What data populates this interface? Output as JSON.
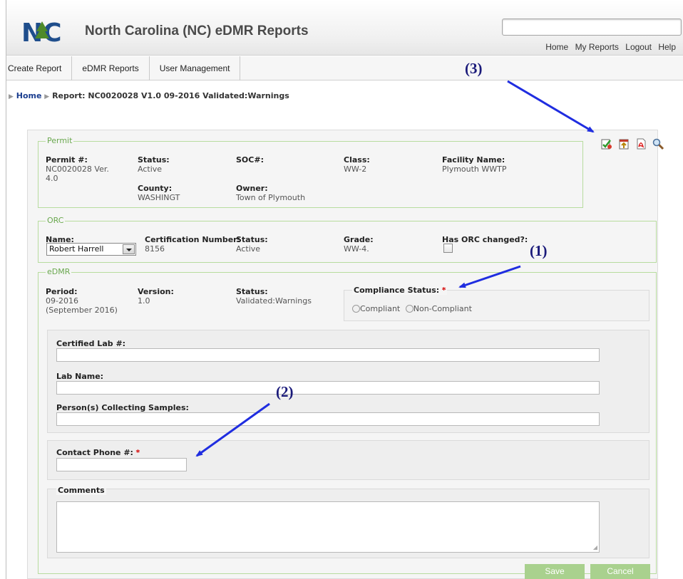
{
  "header": {
    "logo_text": "NC",
    "title": "North Carolina (NC) eDMR Reports",
    "search_placeholder": "",
    "links": [
      "Home",
      "My Reports",
      "Logout",
      "Help"
    ]
  },
  "nav": {
    "tabs": [
      "Create Report",
      "eDMR Reports",
      "User Management"
    ]
  },
  "breadcrumb": {
    "home": "Home",
    "current": "Report: NC0020028 V1.0 09-2016 Validated:Warnings"
  },
  "toolbar": {
    "icons": [
      "validate-icon",
      "upload-icon",
      "pdf-icon",
      "preview-icon"
    ]
  },
  "permit": {
    "legend": "Permit",
    "permit_label": "Permit #:",
    "permit_value_1": "NC0020028 Ver.",
    "permit_value_2": "4.0",
    "status_label": "Status:",
    "status_value": "Active",
    "county_label": "County:",
    "county_value": "WASHINGT",
    "soc_label": "SOC#:",
    "soc_value": "",
    "owner_label": "Owner:",
    "owner_value": "Town of Plymouth",
    "class_label": "Class:",
    "class_value": "WW-2",
    "facility_label": "Facility Name:",
    "facility_value": "Plymouth WWTP"
  },
  "orc": {
    "legend": "ORC",
    "name_label": "Name:",
    "name_value": "Robert Harrell",
    "cert_label": "Certification Number:",
    "cert_value": "8156",
    "status_label": "Status:",
    "status_value": "Active",
    "grade_label": "Grade:",
    "grade_value": "WW-4.",
    "changed_label": "Has ORC changed?:"
  },
  "edmr": {
    "legend": "eDMR",
    "period_label": "Period:",
    "period_value": "09-2016",
    "period_sub": "(September 2016)",
    "version_label": "Version:",
    "version_value": "1.0",
    "status_label": "Status:",
    "status_value": "Validated:Warnings",
    "compliance_label": "Compliance Status:",
    "compliance_options": [
      "Compliant",
      "Non-Compliant"
    ],
    "required_mark": "*",
    "cert_lab_label": "Certified Lab #:",
    "lab_name_label": "Lab Name:",
    "collectors_label": "Person(s) Collecting Samples:",
    "phone_label": "Contact Phone #:",
    "comments_label": "Comments"
  },
  "buttons": {
    "save": "Save",
    "cancel": "Cancel"
  },
  "annotations": {
    "a1": "(1)",
    "a2": "(2)",
    "a3": "(3)",
    "color": "#1a1a7a",
    "arrow_color": "#1f2de0"
  }
}
